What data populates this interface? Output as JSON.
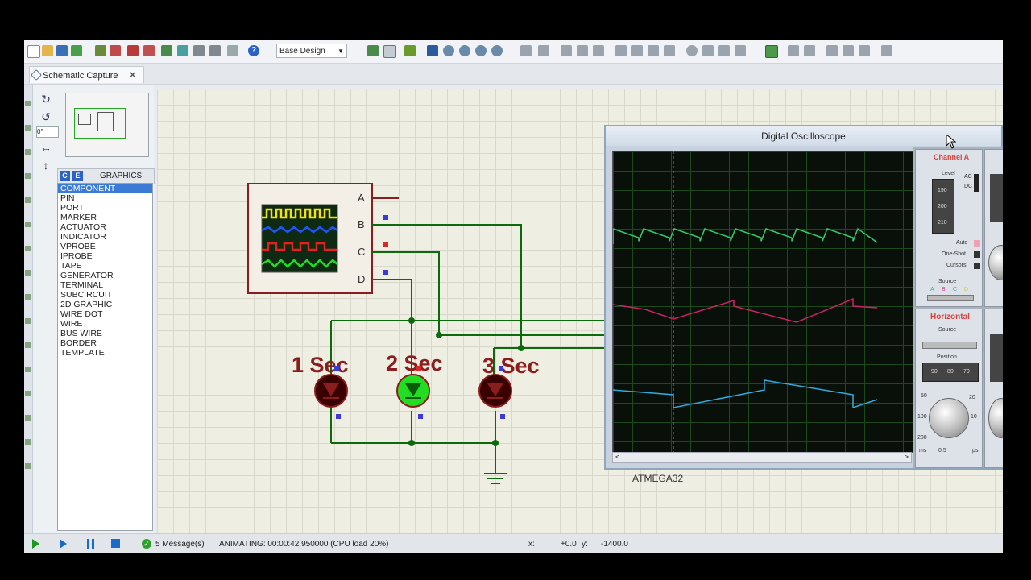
{
  "toolbar": {
    "design_select": "Base Design"
  },
  "tabs": [
    {
      "label": "Schematic Capture"
    }
  ],
  "device_panel": {
    "mode_button_c": "C",
    "mode_button_e": "E",
    "header": "GRAPHICS",
    "items": [
      "COMPONENT",
      "PIN",
      "PORT",
      "MARKER",
      "ACTUATOR",
      "INDICATOR",
      "VPROBE",
      "IPROBE",
      "TAPE",
      "GENERATOR",
      "TERMINAL",
      "SUBCIRCUIT",
      "2D GRAPHIC",
      "WIRE DOT",
      "WIRE",
      "BUS WIRE",
      "BORDER",
      "TEMPLATE"
    ],
    "selected_index": 0,
    "rotation_value": "0°"
  },
  "schematic": {
    "scope_pins": [
      "A",
      "B",
      "C",
      "D"
    ],
    "led_labels": [
      "1 Sec",
      "2 Sec",
      "3 Sec"
    ],
    "led_states": [
      "off",
      "on",
      "off"
    ],
    "mcu_label": "ATMEGA32"
  },
  "oscilloscope": {
    "title": "Digital Oscilloscope",
    "channel_a_label": "Channel A",
    "level_label": "Level",
    "level_ticks": [
      "190",
      "200",
      "210"
    ],
    "ac_label": "AC",
    "dc_label": "DC",
    "auto_label": "Auto",
    "one_shot_label": "One-Shot",
    "cursors_label": "Cursors",
    "source_label": "Source",
    "source_channels": [
      "A",
      "B",
      "C",
      "D"
    ],
    "horizontal_label": "Horizontal",
    "position_label": "Position",
    "position_ticks": [
      "90",
      "80",
      "70"
    ],
    "time_units": [
      "ms",
      "0.5",
      "μs"
    ],
    "knob_scale": [
      "50",
      "100",
      "200",
      "20",
      "10"
    ],
    "trace_colors": {
      "a": "#33cc66",
      "b": "#cc2266",
      "c": "#33aadd"
    }
  },
  "status": {
    "messages": "5 Message(s)",
    "animation": "ANIMATING: 00:00:42.950000 (CPU load 20%)",
    "x_label": "x:",
    "x_value": "+0.0",
    "y_label": "y:",
    "y_value": "-1400.0"
  }
}
